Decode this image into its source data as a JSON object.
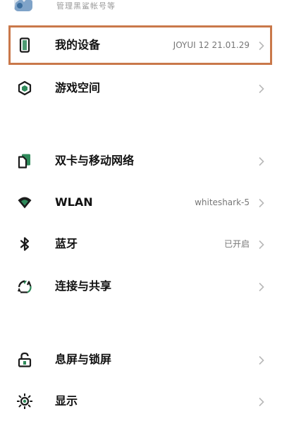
{
  "top_item": {
    "subtitle": "管理黑鲨帐号等"
  },
  "items": [
    {
      "label": "我的设备",
      "value": "JOYUI 12 21.01.29",
      "icon": "phone-device-icon"
    },
    {
      "label": "游戏空间",
      "value": "",
      "icon": "game-cube-icon"
    },
    {
      "label": "双卡与移动网络",
      "value": "",
      "icon": "sim-card-icon"
    },
    {
      "label": "WLAN",
      "value": "whiteshark-5",
      "icon": "wifi-icon"
    },
    {
      "label": "蓝牙",
      "value": "已开启",
      "icon": "bluetooth-icon"
    },
    {
      "label": "连接与共享",
      "value": "",
      "icon": "recycle-share-icon"
    },
    {
      "label": "息屏与锁屏",
      "value": "",
      "icon": "lock-icon"
    },
    {
      "label": "显示",
      "value": "",
      "icon": "sun-display-icon"
    }
  ],
  "colors": {
    "highlight_border": "#c9784a",
    "icon_dark": "#1b1b1b",
    "icon_green": "#2f8a5a",
    "chevron": "#b8b8b8",
    "value_text": "#777777"
  }
}
